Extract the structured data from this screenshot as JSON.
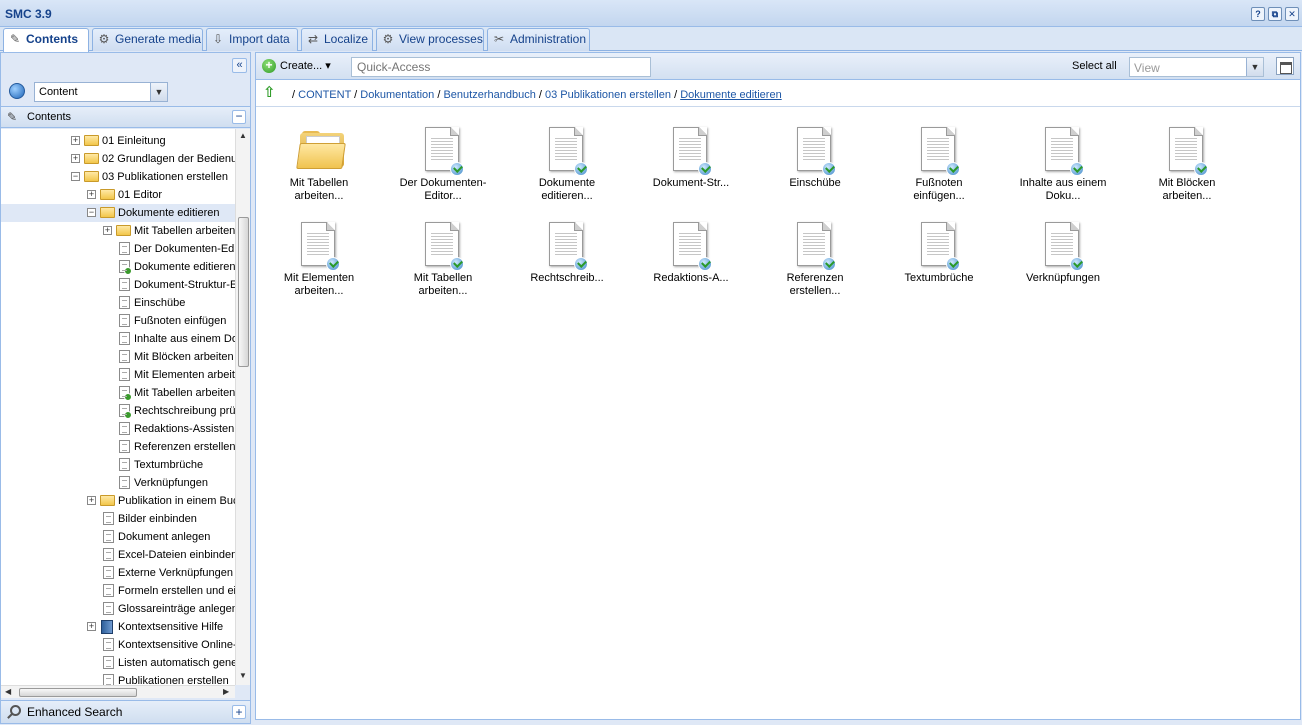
{
  "window": {
    "title": "SMC 3.9",
    "buttons": [
      "?",
      "⧉",
      "✕"
    ]
  },
  "tabs": [
    {
      "label": "Contents",
      "icon": "book-icon",
      "active": true
    },
    {
      "label": "Generate media",
      "icon": "gear-media-icon",
      "active": false
    },
    {
      "label": "Import data",
      "icon": "import-icon",
      "active": false
    },
    {
      "label": "Localize",
      "icon": "localize-icon",
      "active": false
    },
    {
      "label": "View processes",
      "icon": "process-gear-icon",
      "active": false
    },
    {
      "label": "Administration",
      "icon": "wrench-icon",
      "active": false
    }
  ],
  "left": {
    "collapse_glyph": "«",
    "view_select": {
      "value": "Content",
      "arrow": "▼"
    },
    "panel_title": "Contents",
    "minus_glyph": "−",
    "tree": [
      {
        "label": "01 Einleitung",
        "type": "folder",
        "level": 0,
        "expander": "+"
      },
      {
        "label": "02 Grundlagen der Bedienu",
        "type": "folder",
        "level": 0,
        "expander": "+"
      },
      {
        "label": "03 Publikationen erstellen",
        "type": "folder",
        "level": 0,
        "expander": "−"
      },
      {
        "label": "01 Editor",
        "type": "folder",
        "level": 1,
        "expander": "+"
      },
      {
        "label": "Dokumente editieren",
        "type": "folder",
        "level": 1,
        "expander": "−",
        "selected": true
      },
      {
        "label": "Mit Tabellen arbeiten",
        "type": "folder",
        "level": 2,
        "expander": "+"
      },
      {
        "label": "Der Dokumenten-Edit",
        "type": "doc",
        "level": 2
      },
      {
        "label": "Dokumente editieren",
        "type": "doc",
        "level": 2,
        "check": true
      },
      {
        "label": "Dokument-Struktur-Ed",
        "type": "doc",
        "level": 2
      },
      {
        "label": "Einschübe",
        "type": "doc",
        "level": 2
      },
      {
        "label": "Fußnoten einfügen",
        "type": "doc",
        "level": 2
      },
      {
        "label": "Inhalte aus einem Dol",
        "type": "doc",
        "level": 2
      },
      {
        "label": "Mit Blöcken arbeiten",
        "type": "doc",
        "level": 2
      },
      {
        "label": "Mit Elementen arbeite",
        "type": "doc",
        "level": 2
      },
      {
        "label": "Mit Tabellen arbeiten",
        "type": "doc",
        "level": 2,
        "check": true
      },
      {
        "label": "Rechtschreibung prü",
        "type": "doc",
        "level": 2,
        "check": true
      },
      {
        "label": "Redaktions-Assisten",
        "type": "doc",
        "level": 2
      },
      {
        "label": "Referenzen erstellen",
        "type": "doc",
        "level": 2
      },
      {
        "label": "Textumbrüche",
        "type": "doc",
        "level": 2
      },
      {
        "label": "Verknüpfungen",
        "type": "doc",
        "level": 2
      },
      {
        "label": "Publikation in einem Buch",
        "type": "folder",
        "level": 1,
        "expander": "+"
      },
      {
        "label": "Bilder einbinden",
        "type": "doc",
        "level": 1
      },
      {
        "label": "Dokument anlegen",
        "type": "doc",
        "level": 1
      },
      {
        "label": "Excel-Dateien einbinden",
        "type": "doc",
        "level": 1
      },
      {
        "label": "Externe Verknüpfungen",
        "type": "doc",
        "level": 1
      },
      {
        "label": "Formeln erstellen und eir",
        "type": "doc",
        "level": 1
      },
      {
        "label": "Glossareinträge anlegen",
        "type": "doc",
        "level": 1
      },
      {
        "label": "Kontextsensitive Hilfe",
        "type": "book",
        "level": 1,
        "expander": "+"
      },
      {
        "label": "Kontextsensitive Online-",
        "type": "doc",
        "level": 1
      },
      {
        "label": "Listen automatisch gene",
        "type": "doc",
        "level": 1
      },
      {
        "label": "Publikationen erstellen",
        "type": "doc",
        "level": 1
      }
    ],
    "scroll_arrows": {
      "up": "▲",
      "down": "▼",
      "left": "◀",
      "right": "▶"
    },
    "footer_title": "Enhanced Search",
    "plus_glyph": "+"
  },
  "toolbar": {
    "create_label": "Create...",
    "create_arrow": "▾",
    "create_glyph": "+",
    "quick_access_placeholder": "Quick-Access",
    "select_all_label": "Select all",
    "view_select": {
      "value": "View",
      "arrow": "▼"
    }
  },
  "breadcrumb": {
    "up_glyph": "⇧",
    "items": [
      "CONTENT",
      "Dokumentation",
      "Benutzerhandbuch",
      "03 Publikationen erstellen",
      "Dokumente editieren"
    ],
    "separator": "/"
  },
  "grid_items": [
    {
      "line1": "Mit Tabellen",
      "line2": "arbeiten...",
      "type": "folder"
    },
    {
      "line1": "Der Dokumenten-",
      "line2": "Editor...",
      "type": "doc"
    },
    {
      "line1": "Dokumente",
      "line2": "editieren...",
      "type": "doc"
    },
    {
      "line1": "Dokument-Str...",
      "line2": "",
      "type": "doc"
    },
    {
      "line1": "Einschübe",
      "line2": "",
      "type": "doc"
    },
    {
      "line1": "Fußnoten",
      "line2": "einfügen...",
      "type": "doc"
    },
    {
      "line1": "Inhalte aus einem",
      "line2": "Doku...",
      "type": "doc"
    },
    {
      "line1": "Mit Blöcken",
      "line2": "arbeiten...",
      "type": "doc"
    },
    {
      "line1": "Mit Elementen",
      "line2": "arbeiten...",
      "type": "doc"
    },
    {
      "line1": "Mit Tabellen",
      "line2": "arbeiten...",
      "type": "doc"
    },
    {
      "line1": "Rechtschreib...",
      "line2": "",
      "type": "doc"
    },
    {
      "line1": "Redaktions-A...",
      "line2": "",
      "type": "doc"
    },
    {
      "line1": "Referenzen",
      "line2": "erstellen...",
      "type": "doc"
    },
    {
      "line1": "Textumbrüche",
      "line2": "",
      "type": "doc"
    },
    {
      "line1": "Verknüpfungen",
      "line2": "",
      "type": "doc"
    }
  ]
}
